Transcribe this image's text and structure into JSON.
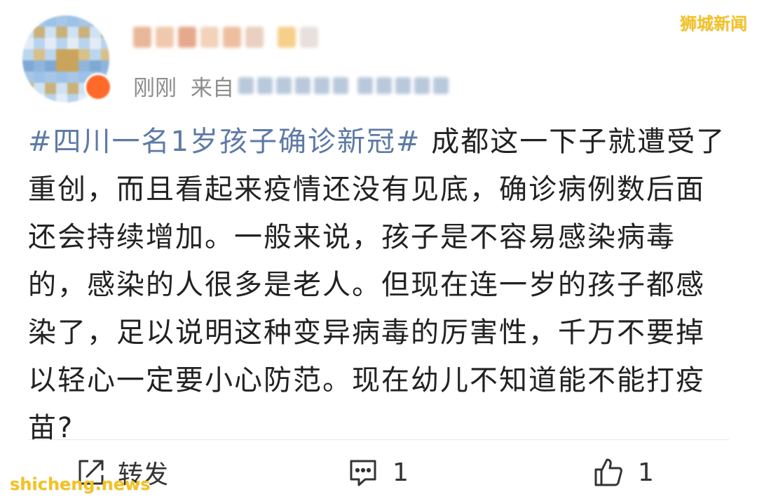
{
  "header": {
    "time_label": "刚刚",
    "source_prefix": "来自"
  },
  "post": {
    "hashtag": "#四川一名1岁孩子确诊新冠#",
    "body": " 成都这一下子就遭受了重创，而且看起来疫情还没有见底，确诊病例数后面还会持续增加。一般来说，孩子是不容易感染病毒的，感染的人很多是老人。但现在连一岁的孩子都感染了，足以说明这种变异病毒的厉害性，千万不要掉以轻心一定要小心防范。现在幼儿不知道能不能打疫苗?"
  },
  "actions": {
    "repost_label": "转发",
    "comment_count": "1",
    "like_count": "1"
  },
  "watermarks": {
    "top_right": "狮城新闻",
    "bottom_left": "shicheng.news"
  },
  "colors": {
    "hashtag": "#5d7aa6",
    "meta_text": "#8d8d8d",
    "watermark": "#f4c21f"
  },
  "icons": [
    "repost-icon",
    "comment-icon",
    "like-icon"
  ]
}
